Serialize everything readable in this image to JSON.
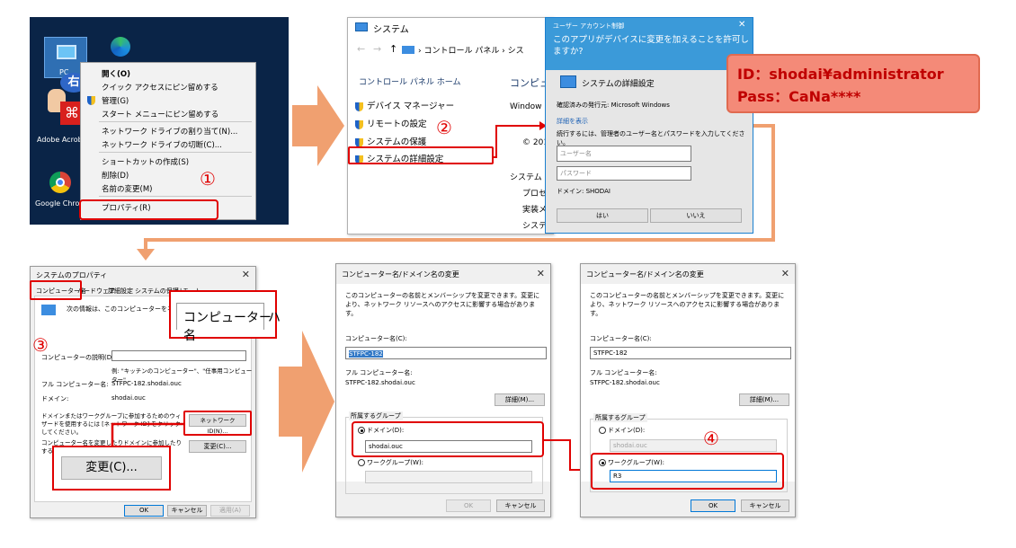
{
  "desktop": {
    "icons": [
      {
        "label": "PC"
      },
      {
        "label": "Adobe Acrob"
      },
      {
        "label": "Google Chro"
      }
    ],
    "right_click_badge": "右",
    "menu": [
      "開く(O)",
      "クイック アクセスにピン留めする",
      "管理(G)",
      "スタート メニューにピン留めする",
      "ネットワーク ドライブの割り当て(N)...",
      "ネットワーク ドライブの切断(C)...",
      "ショートカットの作成(S)",
      "削除(D)",
      "名前の変更(M)",
      "プロパティ(R)"
    ]
  },
  "steps": {
    "s1": "①",
    "s2": "②",
    "s3": "③",
    "s4": "④"
  },
  "system": {
    "title": "システム",
    "breadcrumb": "› コントロール パネル › シス",
    "home": "コントロール パネル ホーム",
    "links": [
      "デバイス マネージャー",
      "リモートの設定",
      "システムの保護",
      "システムの詳細設定"
    ],
    "right_heading": "コンピュ",
    "windows": "Window",
    "copyright": "© 201",
    "section": "システム —",
    "rows": [
      "プロセ",
      "実装メ",
      "システ"
    ]
  },
  "uac": {
    "header": "ユーザー アカウント制御",
    "question": "このアプリがデバイスに変更を加えることを許可しますか?",
    "app": "システムの詳細設定",
    "publisher": "確認済みの発行元: Microsoft Windows",
    "details": "詳細を表示",
    "prompt": "続行するには、管理者のユーザー名とパスワードを入力してください。",
    "user_placeholder": "ユーザー名",
    "pass_placeholder": "パスワード",
    "domain": "ドメイン: SHODAI",
    "yes": "はい",
    "no": "いいえ"
  },
  "credentials": {
    "id": "ID：shodai¥administrator",
    "pass": "Pass：CaNa****"
  },
  "sysprop": {
    "title": "システムのプロパティ",
    "tabs": [
      "コンピューター名",
      "ハードウェア",
      "詳細設定",
      "システムの保護",
      "リモート"
    ],
    "info": "次の情報は、このコンピューターをネットワーク上",
    "zoom_tab": "コンピューター名",
    "zoom_tab2": "ハ",
    "desc_label": "コンピューターの説明(D):",
    "desc_example": "例: \"キッチンのコンピューター\"、\"任事用コンピューター\"",
    "full_label": "フル コンピューター名:",
    "full_value": "STFPC-182.shodai.ouc",
    "domain_label": "ドメイン:",
    "domain_value": "shodai.ouc",
    "wizard_text": "ドメインまたはワークグループに参加するためのウィザードを使用するには [ネットワーク ID] をクリックしてください。",
    "netid": "ネットワーク ID(N)...",
    "change_text": "コンピューター名を変更したりドメインに参加したりするには [変更] をクリックしてください。",
    "change": "変更(C)...",
    "change_zoom": "変更(C)...",
    "ok": "OK",
    "cancel": "キャンセル",
    "apply": "適用(A)"
  },
  "rename1": {
    "title": "コンピューター名/ドメイン名の変更",
    "desc": "このコンピューターの名前とメンバーシップを変更できます。変更により、ネットワーク リソースへのアクセスに影響する場合があります。",
    "name_label": "コンピューター名(C):",
    "name_value": "STFPC-182",
    "full_label": "フル コンピューター名:",
    "full_value": "STFPC-182.shodai.ouc",
    "details": "詳細(M)...",
    "group_label": "所属するグループ",
    "domain_radio": "ドメイン(D):",
    "domain_value": "shodai.ouc",
    "workgroup_radio": "ワークグループ(W):",
    "workgroup_value": "",
    "ok": "OK",
    "cancel": "キャンセル"
  },
  "rename2": {
    "title": "コンピューター名/ドメイン名の変更",
    "desc": "このコンピューターの名前とメンバーシップを変更できます。変更により、ネットワーク リソースへのアクセスに影響する場合があります。",
    "name_label": "コンピューター名(C):",
    "name_value": "STFPC-182",
    "full_label": "フル コンピューター名:",
    "full_value": "STFPC-182.shodai.ouc",
    "details": "詳細(M)...",
    "group_label": "所属するグループ",
    "domain_radio": "ドメイン(D):",
    "domain_value": "shodai.ouc",
    "workgroup_radio": "ワークグループ(W):",
    "workgroup_value": "R3",
    "ok": "OK",
    "cancel": "キャンセル"
  },
  "colors": {
    "arrow": "#f0a070",
    "highlight": "#e00000",
    "cred_bg": "#f48a78"
  }
}
